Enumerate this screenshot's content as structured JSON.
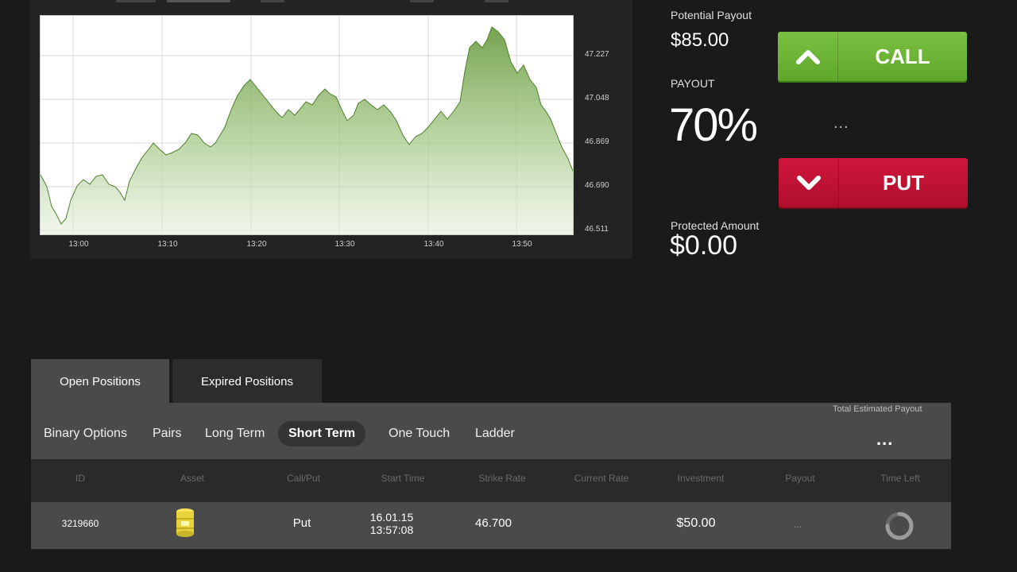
{
  "chart": {
    "y_ticks": [
      "47.227",
      "47.048",
      "46.869",
      "46.690",
      "46.511"
    ],
    "x_ticks": [
      "13:00",
      "13:10",
      "13:20",
      "13:30",
      "13:40",
      "13:50"
    ],
    "fill_color": "#7aa84e",
    "line_color": "#4f7f2d"
  },
  "trade": {
    "potential_payout_label": "Potential Payout",
    "potential_payout_value": "$85.00",
    "payout_label": "PAYOUT",
    "payout_value": "70%",
    "mid_dots": "...",
    "protected_label": "Protected Amount",
    "protected_value": "$0.00",
    "call_label": "CALL",
    "put_label": "PUT",
    "call_color": "#6db33a",
    "put_color": "#c4122f",
    "call_icon": "chevron-up-icon",
    "put_icon": "chevron-down-icon"
  },
  "positions": {
    "tabs": [
      "Open Positions",
      "Expired Positions"
    ],
    "active_tab": "Open Positions",
    "filters": [
      "Binary Options",
      "Pairs",
      "Long Term",
      "Short Term",
      "One Touch",
      "Ladder"
    ],
    "active_filter": "Short Term",
    "total_label": "Total Estimated Payout",
    "total_value": "...",
    "columns": [
      "ID",
      "Asset",
      "Call/Put",
      "Start Time",
      "Strike Rate",
      "Current Rate",
      "Investment",
      "Payout",
      "Time Left"
    ],
    "rows": [
      {
        "id": "3219660",
        "asset_icon": "oil-barrel-icon",
        "call_put": "Put",
        "start_date": "16.01.15",
        "start_time": "13:57:08",
        "strike_rate": "46.700",
        "current_rate": "",
        "investment": "$50.00",
        "payout": "...",
        "time_left_icon": "loading-spinner-icon"
      }
    ]
  }
}
